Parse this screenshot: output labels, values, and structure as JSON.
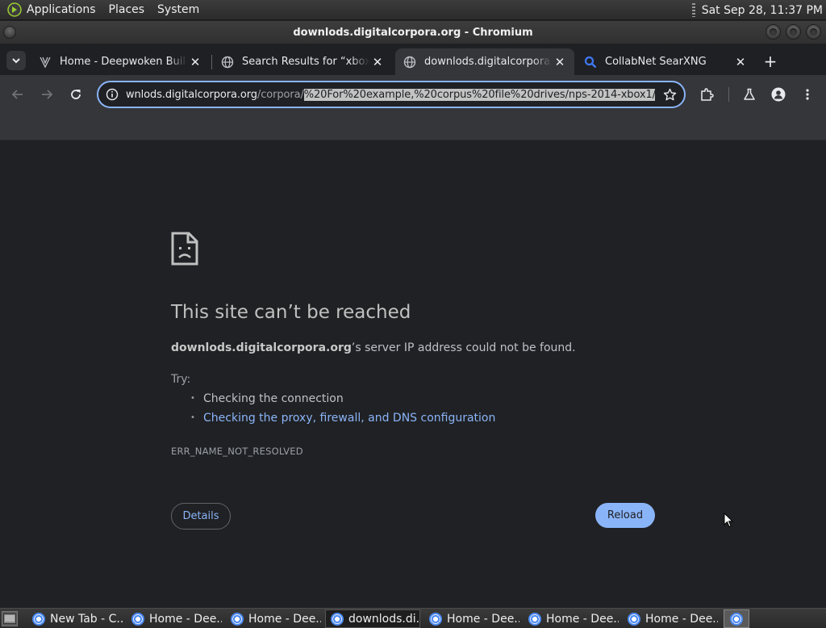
{
  "top_panel": {
    "menus": [
      "Applications",
      "Places",
      "System"
    ],
    "clock": "Sat Sep 28, 11:37 PM"
  },
  "window": {
    "title": "downlods.digitalcorpora.org - Chromium"
  },
  "tabs": [
    {
      "title": "Home - Deepwoken Builder",
      "favicon": "deepwoken-logo-icon",
      "active": false
    },
    {
      "title": "Search Results for “xbox” –",
      "favicon": "globe-icon",
      "active": false
    },
    {
      "title": "downlods.digitalcorpora.org",
      "favicon": "globe-icon",
      "active": true
    },
    {
      "title": "CollabNet SearXNG",
      "favicon": "search-icon",
      "active": false
    }
  ],
  "tab_close_glyph": "✕",
  "new_tab_glyph": "+",
  "omnibox": {
    "url_host": "wnlods.digitalcorpora.org",
    "url_path": "/corpora/",
    "url_selected": "%20For%20example,%20corpus%20file%20drives/nps-2014-xbox1/"
  },
  "error_page": {
    "heading": "This site can’t be reached",
    "host": "downlods.digitalcorpora.org",
    "message_suffix": "’s server IP address could not be found.",
    "try_label": "Try:",
    "suggestions": [
      {
        "text": "Checking the connection",
        "link": false
      },
      {
        "text": "Checking the proxy, firewall, and DNS configuration",
        "link": true
      }
    ],
    "error_code": "ERR_NAME_NOT_RESOLVED",
    "details_label": "Details",
    "reload_label": "Reload"
  },
  "taskbar": {
    "items": [
      {
        "label": "New Tab - C..."
      },
      {
        "label": "Home - Dee..."
      },
      {
        "label": "Home - Dee..."
      },
      {
        "label": "downlods.di...",
        "active": true
      },
      {
        "label": "Home - Dee..."
      },
      {
        "label": "Home - Dee..."
      },
      {
        "label": "Home - Dee..."
      }
    ]
  },
  "colors": {
    "accent": "#8ab4f8",
    "page_bg": "#202124",
    "toolbar_bg": "#35363a"
  }
}
